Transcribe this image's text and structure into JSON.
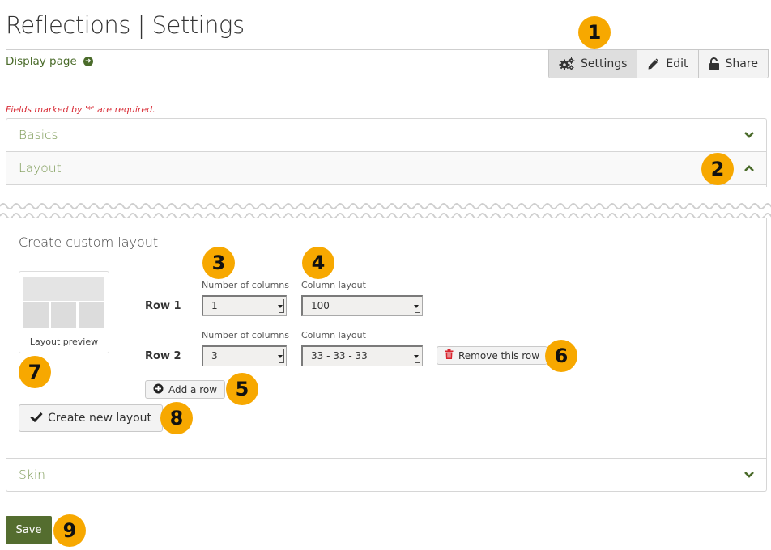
{
  "page": {
    "title": "Reflections | Settings",
    "display_link": "Display page"
  },
  "toolbar": {
    "settings_label": "Settings",
    "edit_label": "Edit",
    "share_label": "Share"
  },
  "form": {
    "required_note": "Fields marked by '*' are required.",
    "sections": {
      "basics": "Basics",
      "layout": "Layout",
      "skin": "Skin"
    },
    "custom_layout": {
      "title": "Create custom layout",
      "preview_label": "Layout preview",
      "rows": [
        {
          "label": "Row 1",
          "num_columns_label": "Number of columns",
          "num_columns_value": "1",
          "column_layout_label": "Column layout",
          "column_layout_value": "100"
        },
        {
          "label": "Row 2",
          "num_columns_label": "Number of columns",
          "num_columns_value": "3",
          "column_layout_label": "Column layout",
          "column_layout_value": "33 - 33 - 33",
          "remove_label": "Remove this row"
        }
      ],
      "add_row_label": "Add a row",
      "create_label": "Create new layout"
    },
    "save_label": "Save"
  },
  "annotations": [
    "1",
    "2",
    "3",
    "4",
    "5",
    "6",
    "7",
    "8",
    "9"
  ],
  "colors": {
    "accent_green": "#546d2f",
    "link_green": "#4a6b2a",
    "section_green": "#7c9a55",
    "required_red": "#d9303a",
    "badge_orange": "#f7a800",
    "trash_red": "#d9232d"
  }
}
